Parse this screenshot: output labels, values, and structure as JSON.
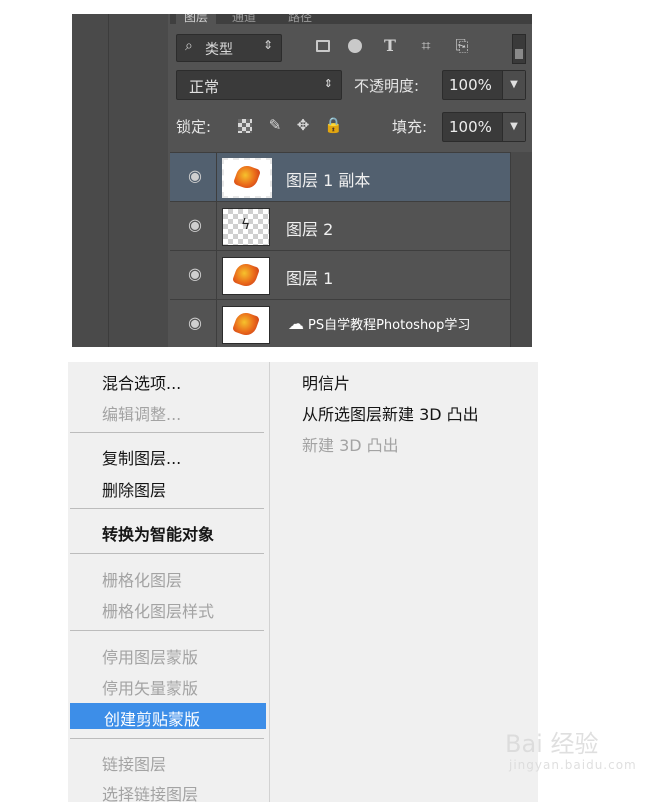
{
  "layers_panel": {
    "tabs": [
      "图层",
      "通道",
      "路径"
    ],
    "filter": {
      "icon": "search-icon",
      "label": "类型",
      "chevron": "⇕"
    },
    "filter_icons": [
      "image-icon",
      "adjustment-icon",
      "text-icon",
      "shape-icon",
      "smart-object-icon"
    ],
    "filter_text_glyph": "T",
    "blend_mode": "正常",
    "opacity_label": "不透明度:",
    "opacity_value": "100%",
    "lock_label": "锁定:",
    "lock_icons": [
      "lock-transparent-icon",
      "lock-paint-icon",
      "lock-position-icon",
      "lock-all-icon"
    ],
    "fill_label": "填充:",
    "fill_value": "100%",
    "layers": [
      {
        "name": "图层 1 副本",
        "selected": true,
        "thumb": "leaf"
      },
      {
        "name": "图层 2",
        "selected": false,
        "thumb": "transparent"
      },
      {
        "name": "图层 1",
        "selected": false,
        "thumb": "leaf"
      },
      {
        "name": "PS自学教程Photoshop学习",
        "selected": false,
        "thumb": "leaf"
      }
    ]
  },
  "context_menu": {
    "left": [
      {
        "label": "混合选项...",
        "enabled": true
      },
      {
        "label": "编辑调整...",
        "enabled": false
      },
      {
        "label": "复制图层...",
        "enabled": true
      },
      {
        "label": "删除图层",
        "enabled": true
      },
      {
        "label": "转换为智能对象",
        "enabled": true
      },
      {
        "label": "栅格化图层",
        "enabled": false
      },
      {
        "label": "栅格化图层样式",
        "enabled": false
      },
      {
        "label": "停用图层蒙版",
        "enabled": false
      },
      {
        "label": "停用矢量蒙版",
        "enabled": false
      },
      {
        "label": "创建剪贴蒙版",
        "enabled": true,
        "highlighted": true
      },
      {
        "label": "链接图层",
        "enabled": false
      },
      {
        "label": "选择链接图层",
        "enabled": false
      }
    ],
    "right": [
      {
        "label": "明信片",
        "enabled": true
      },
      {
        "label": "从所选图层新建 3D 凸出",
        "enabled": true
      },
      {
        "label": "新建 3D 凸出",
        "enabled": false
      }
    ],
    "highlight_color": "#3d8ee8"
  },
  "watermark": {
    "text": "Bai 经验",
    "sub": "jingyan.baidu.com"
  }
}
